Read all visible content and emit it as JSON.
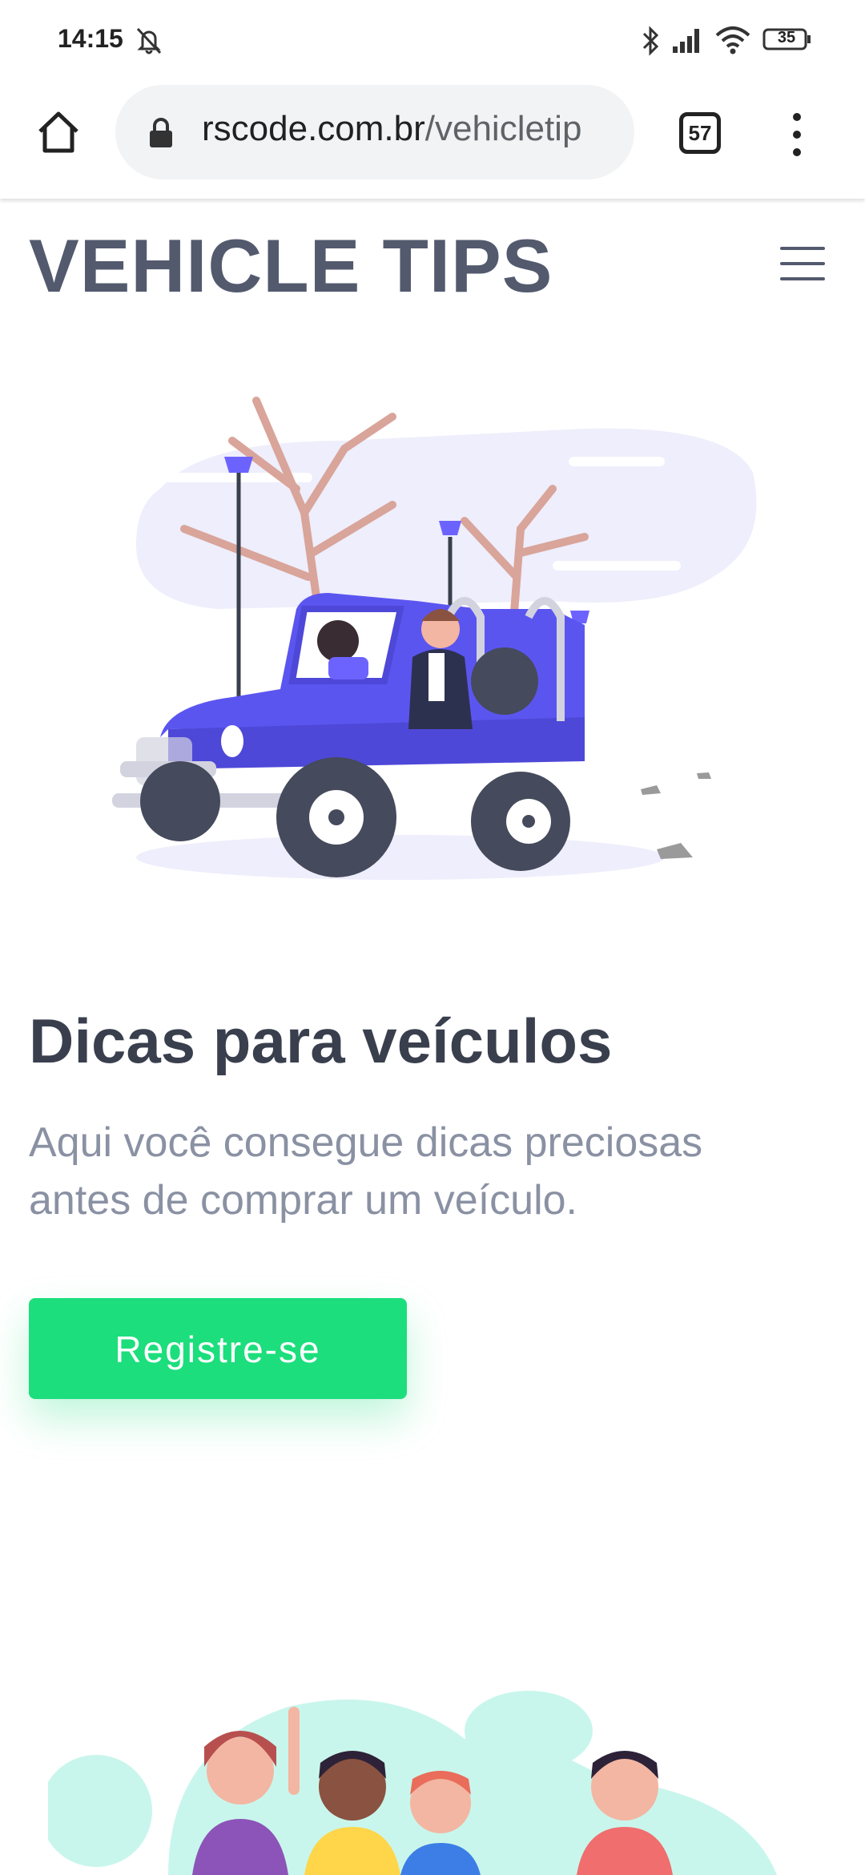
{
  "status_bar": {
    "time": "14:15",
    "battery_level": "35",
    "icons": [
      "mute-icon",
      "bluetooth-icon",
      "signal-icon",
      "wifi-icon",
      "battery-icon"
    ]
  },
  "browser": {
    "url_domain": "rscode.com.br",
    "url_path": "/vehicletip",
    "tab_count": "57",
    "icons": [
      "home-icon",
      "lock-icon",
      "overflow-menu-icon"
    ]
  },
  "site": {
    "title": "VEHICLE TIPS",
    "menu_icon": "hamburger-icon"
  },
  "hero": {
    "heading": "Dicas para veículos",
    "subtitle": "Aqui você consegue dicas preciosas antes de comprar um veículo.",
    "button_label": "Registre-se",
    "button_color": "#1cde7c"
  },
  "colors": {
    "title": "#535a6e",
    "heading": "#3a3f4e",
    "subtitle": "#8a91a3",
    "accent": "#6c63ff"
  }
}
